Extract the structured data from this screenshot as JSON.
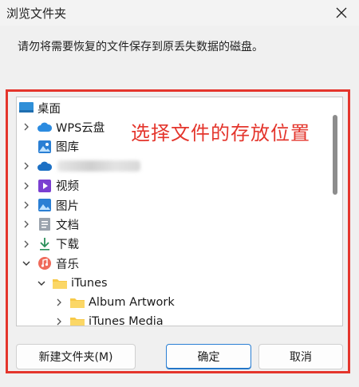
{
  "window": {
    "title": "浏览文件夹",
    "close_icon": "close-icon"
  },
  "instruction": "请勿将需要恢复的文件保存到原丢失数据的磁盘。",
  "annotation": "选择文件的存放位置",
  "tree": [
    {
      "label": "桌面",
      "icon": "desktop-icon",
      "depth": 0,
      "chevron": "none"
    },
    {
      "label": "WPS云盘",
      "icon": "cloud-icon",
      "depth": 1,
      "chevron": "right"
    },
    {
      "label": "图库",
      "icon": "gallery-icon",
      "depth": 1,
      "chevron": "none"
    },
    {
      "label": "",
      "icon": "onedrive-icon",
      "depth": 1,
      "chevron": "right",
      "obscured": true
    },
    {
      "label": "视频",
      "icon": "video-icon",
      "depth": 1,
      "chevron": "right"
    },
    {
      "label": "图片",
      "icon": "pictures-icon",
      "depth": 1,
      "chevron": "right"
    },
    {
      "label": "文档",
      "icon": "documents-icon",
      "depth": 1,
      "chevron": "right"
    },
    {
      "label": "下载",
      "icon": "download-icon",
      "depth": 1,
      "chevron": "right"
    },
    {
      "label": "音乐",
      "icon": "music-icon",
      "depth": 1,
      "chevron": "down"
    },
    {
      "label": "iTunes",
      "icon": "folder-icon",
      "depth": 2,
      "chevron": "down"
    },
    {
      "label": "Album Artwork",
      "icon": "folder-icon",
      "depth": 3,
      "chevron": "right"
    },
    {
      "label": "iTunes Media",
      "icon": "folder-icon",
      "depth": 3,
      "chevron": "right"
    }
  ],
  "buttons": {
    "new_folder": "新建文件夹(M)",
    "ok": "确定",
    "cancel": "取消"
  },
  "colors": {
    "highlight_red": "#e4352c",
    "accent_blue": "#2a7fd4",
    "folder_yellow": "#f7c948"
  }
}
